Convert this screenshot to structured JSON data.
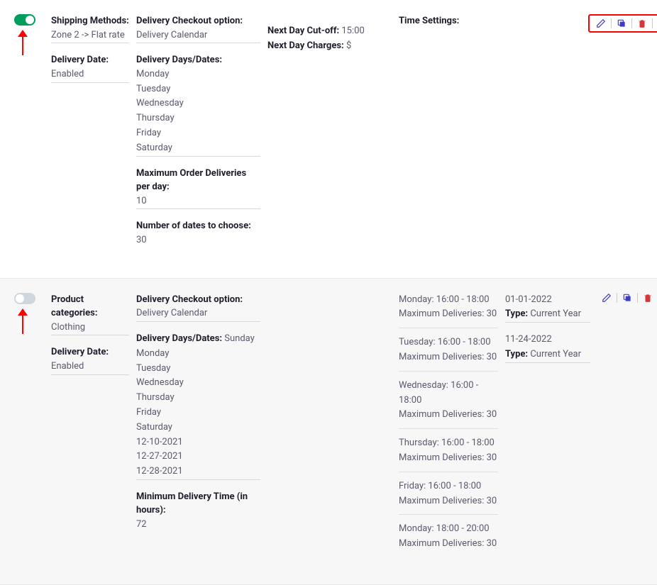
{
  "rows": [
    {
      "toggle_on": true,
      "colA_label": "Shipping Methods:",
      "colA_value": "Zone 2 -> Flat rate",
      "colA2_label": "Delivery Date:",
      "colA2_value": "Enabled",
      "colB_checkout_label": "Delivery Checkout option:",
      "colB_checkout_value": "Delivery Calendar",
      "colB_days_label": "Delivery Days/Dates:",
      "colB_days": [
        "Monday",
        "Tuesday",
        "Wednesday",
        "Thursday",
        "Friday",
        "Saturday"
      ],
      "colB_max_label": "Maximum Order Deliveries per day:",
      "colB_max_value": "10",
      "colB_num_label": "Number of dates to choose:",
      "colB_num_value": "30",
      "colC_nextday_label": "Next Day Cut-off:",
      "colC_nextday_value": "15:00",
      "colC_charges_label": "Next Day Charges:",
      "colC_charges_value": "$",
      "colD_time_label": "Time Settings:",
      "highlight_actions": true
    },
    {
      "toggle_on": false,
      "colA_label": "Product categories:",
      "colA_value": "Clothing",
      "colA2_label": "Delivery Date:",
      "colA2_value": "Enabled",
      "colB_checkout_label": "Delivery Checkout option:",
      "colB_checkout_value": "Delivery Calendar",
      "colB_days_label": "Delivery Days/Dates:",
      "colB_days_inline": "Sunday",
      "colB_days": [
        "Monday",
        "Tuesday",
        "Wednesday",
        "Thursday",
        "Friday",
        "Saturday",
        "12-10-2021",
        "12-27-2021",
        "12-28-2021"
      ],
      "colB_min_label": "Minimum Delivery Time (in hours):",
      "colB_min_value": "72",
      "timeslots": [
        {
          "line1": "Monday: 16:00 - 18:00",
          "line2": "Maximum Deliveries: 30"
        },
        {
          "line1": "Tuesday: 16:00 - 18:00",
          "line2": "Maximum Deliveries: 30"
        },
        {
          "line1": "Wednesday: 16:00 - 18:00",
          "line2": "Maximum Deliveries: 30"
        },
        {
          "line1": "Thursday: 16:00 - 18:00",
          "line2": "Maximum Deliveries: 30"
        },
        {
          "line1": "Friday: 16:00 - 18:00",
          "line2": "Maximum Deliveries: 30"
        },
        {
          "line1": "Monday: 18:00 - 20:00",
          "line2": "Maximum Deliveries: 30"
        }
      ],
      "dates": [
        {
          "date": "01-01-2022",
          "type_label": "Type:",
          "type_value": "Current Year"
        },
        {
          "date": "11-24-2022",
          "type_label": "Type:",
          "type_value": "Current Year"
        }
      ],
      "highlight_actions": false
    }
  ]
}
